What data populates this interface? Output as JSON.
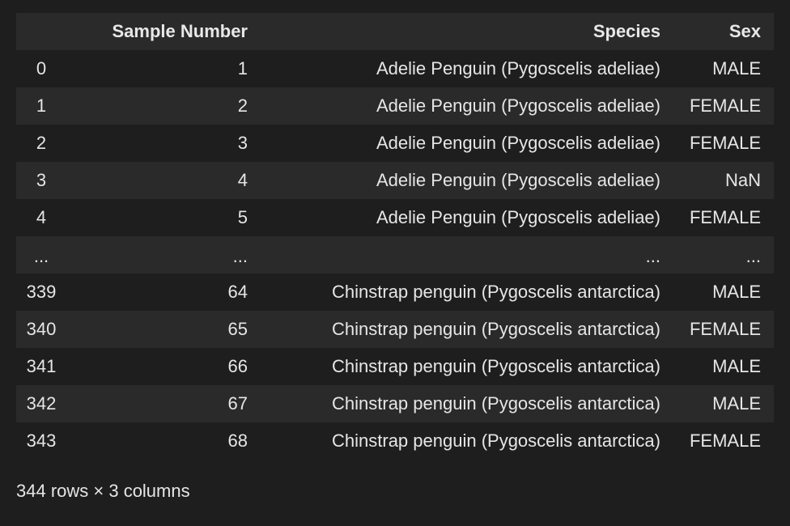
{
  "table": {
    "columns": [
      "",
      "Sample Number",
      "Species",
      "Sex"
    ],
    "rows": [
      [
        "0",
        "1",
        "Adelie Penguin (Pygoscelis adeliae)",
        "MALE"
      ],
      [
        "1",
        "2",
        "Adelie Penguin (Pygoscelis adeliae)",
        "FEMALE"
      ],
      [
        "2",
        "3",
        "Adelie Penguin (Pygoscelis adeliae)",
        "FEMALE"
      ],
      [
        "3",
        "4",
        "Adelie Penguin (Pygoscelis adeliae)",
        "NaN"
      ],
      [
        "4",
        "5",
        "Adelie Penguin (Pygoscelis adeliae)",
        "FEMALE"
      ],
      [
        "...",
        "...",
        "...",
        "..."
      ],
      [
        "339",
        "64",
        "Chinstrap penguin (Pygoscelis antarctica)",
        "MALE"
      ],
      [
        "340",
        "65",
        "Chinstrap penguin (Pygoscelis antarctica)",
        "FEMALE"
      ],
      [
        "341",
        "66",
        "Chinstrap penguin (Pygoscelis antarctica)",
        "MALE"
      ],
      [
        "342",
        "67",
        "Chinstrap penguin (Pygoscelis antarctica)",
        "MALE"
      ],
      [
        "343",
        "68",
        "Chinstrap penguin (Pygoscelis antarctica)",
        "FEMALE"
      ]
    ]
  },
  "footer": {
    "summary": "344 rows × 3 columns"
  }
}
